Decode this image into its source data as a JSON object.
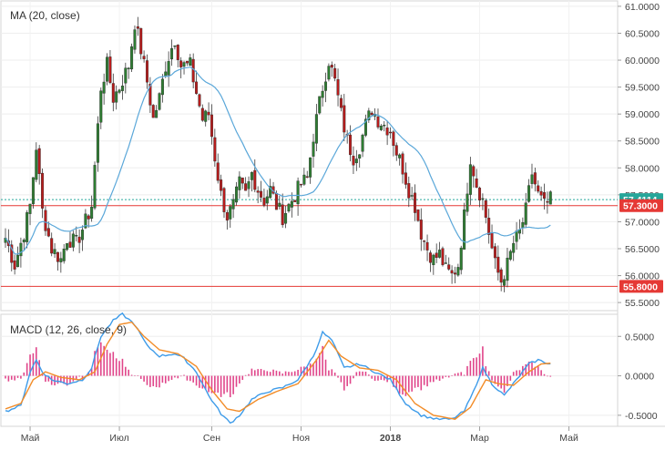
{
  "chart_data": [
    {
      "type": "candlestick",
      "title": "MA (20, close)",
      "ylim": [
        55.35,
        61.1
      ],
      "yticks": [
        "61.0000",
        "60.5000",
        "60.0000",
        "59.5000",
        "59.0000",
        "58.5000",
        "58.0000",
        "57.5000",
        "57.0000",
        "56.5000",
        "56.0000",
        "55.5000"
      ],
      "yvalues": [
        61.0,
        60.5,
        60.0,
        59.5,
        59.0,
        58.5,
        58.0,
        57.5,
        57.0,
        56.5,
        56.0,
        55.5
      ],
      "horizontal_lines": [
        {
          "label": "57.3000",
          "value": 57.3,
          "color": "#e53935"
        },
        {
          "label": "55.8000",
          "value": 55.8,
          "color": "#e53935"
        }
      ],
      "last_price": {
        "label": "57.4114",
        "value": 57.4114,
        "color": "#26a69a"
      },
      "series_colors": {
        "up": "#2e7d32",
        "down": "#b71c1c",
        "ma": "#5aa7d9"
      },
      "anchors": [
        [
          0,
          56.7
        ],
        [
          3,
          56.2
        ],
        [
          6,
          56.8
        ],
        [
          8,
          57.3
        ],
        [
          10,
          58.4
        ],
        [
          12,
          57.2
        ],
        [
          15,
          56.5
        ],
        [
          18,
          56.3
        ],
        [
          20,
          56.7
        ],
        [
          23,
          56.6
        ],
        [
          26,
          57.0
        ],
        [
          28,
          57.3
        ],
        [
          31,
          59.5
        ],
        [
          33,
          59.9
        ],
        [
          35,
          59.3
        ],
        [
          37,
          59.5
        ],
        [
          40,
          59.9
        ],
        [
          42,
          60.7
        ],
        [
          44,
          60.2
        ],
        [
          46,
          59.6
        ],
        [
          48,
          58.9
        ],
        [
          50,
          59.3
        ],
        [
          52,
          59.9
        ],
        [
          55,
          60.4
        ],
        [
          57,
          59.9
        ],
        [
          60,
          59.9
        ],
        [
          62,
          59.4
        ],
        [
          64,
          58.9
        ],
        [
          66,
          59.0
        ],
        [
          68,
          58.2
        ],
        [
          70,
          57.5
        ],
        [
          72,
          57.1
        ],
        [
          74,
          57.3
        ],
        [
          76,
          57.7
        ],
        [
          78,
          57.5
        ],
        [
          80,
          57.9
        ],
        [
          82,
          57.6
        ],
        [
          84,
          57.4
        ],
        [
          86,
          57.6
        ],
        [
          88,
          57.3
        ],
        [
          90,
          57.1
        ],
        [
          92,
          57.3
        ],
        [
          94,
          57.5
        ],
        [
          96,
          57.7
        ],
        [
          98,
          57.8
        ],
        [
          100,
          58.6
        ],
        [
          103,
          59.5
        ],
        [
          105,
          60.0
        ],
        [
          107,
          59.6
        ],
        [
          109,
          59.0
        ],
        [
          111,
          58.5
        ],
        [
          113,
          58.2
        ],
        [
          115,
          58.4
        ],
        [
          117,
          58.8
        ],
        [
          119,
          59.1
        ],
        [
          121,
          58.9
        ],
        [
          123,
          58.8
        ],
        [
          125,
          58.7
        ],
        [
          127,
          58.3
        ],
        [
          129,
          58.0
        ],
        [
          131,
          57.6
        ],
        [
          133,
          57.3
        ],
        [
          135,
          56.8
        ],
        [
          137,
          56.5
        ],
        [
          139,
          56.3
        ],
        [
          141,
          56.4
        ],
        [
          143,
          56.1
        ],
        [
          145,
          56.0
        ],
        [
          147,
          56.2
        ],
        [
          149,
          57.1
        ],
        [
          151,
          58.2
        ],
        [
          153,
          57.7
        ],
        [
          155,
          57.4
        ],
        [
          157,
          56.8
        ],
        [
          159,
          56.2
        ],
        [
          161,
          55.9
        ],
        [
          163,
          56.2
        ],
        [
          165,
          56.6
        ],
        [
          167,
          56.8
        ],
        [
          169,
          57.2
        ],
        [
          171,
          57.9
        ],
        [
          173,
          57.5
        ],
        [
          175,
          57.3
        ],
        [
          177,
          57.4
        ]
      ]
    },
    {
      "type": "macd",
      "title": "MACD (12, 26, close, 9)",
      "ylim": [
        -0.64,
        0.78
      ],
      "yticks": [
        "0.5000",
        "0.0000",
        "-0.5000"
      ],
      "yvalues": [
        0.5,
        0.0,
        -0.5
      ],
      "series_colors": {
        "macd": "#3d9be9",
        "signal": "#f28c28",
        "histogram": "#e0458a"
      },
      "macd_anchors": [
        [
          0,
          -0.45
        ],
        [
          5,
          -0.38
        ],
        [
          8,
          0.05
        ],
        [
          10,
          0.2
        ],
        [
          12,
          0.05
        ],
        [
          15,
          -0.05
        ],
        [
          20,
          -0.1
        ],
        [
          25,
          -0.05
        ],
        [
          28,
          0.1
        ],
        [
          31,
          0.5
        ],
        [
          35,
          0.7
        ],
        [
          38,
          0.78
        ],
        [
          42,
          0.65
        ],
        [
          46,
          0.38
        ],
        [
          50,
          0.25
        ],
        [
          55,
          0.28
        ],
        [
          58,
          0.22
        ],
        [
          62,
          0.05
        ],
        [
          66,
          -0.25
        ],
        [
          70,
          -0.48
        ],
        [
          73,
          -0.6
        ],
        [
          76,
          -0.5
        ],
        [
          80,
          -0.3
        ],
        [
          85,
          -0.2
        ],
        [
          90,
          -0.15
        ],
        [
          95,
          -0.05
        ],
        [
          100,
          0.25
        ],
        [
          103,
          0.55
        ],
        [
          106,
          0.45
        ],
        [
          110,
          0.1
        ],
        [
          115,
          0.15
        ],
        [
          120,
          0.05
        ],
        [
          125,
          -0.05
        ],
        [
          130,
          -0.35
        ],
        [
          135,
          -0.5
        ],
        [
          140,
          -0.55
        ],
        [
          145,
          -0.55
        ],
        [
          149,
          -0.45
        ],
        [
          152,
          -0.2
        ],
        [
          155,
          0.1
        ],
        [
          158,
          -0.1
        ],
        [
          162,
          -0.25
        ],
        [
          166,
          -0.05
        ],
        [
          170,
          0.15
        ],
        [
          173,
          0.2
        ],
        [
          177,
          0.15
        ]
      ],
      "signal_anchors": [
        [
          0,
          -0.42
        ],
        [
          5,
          -0.35
        ],
        [
          9,
          -0.05
        ],
        [
          13,
          0.05
        ],
        [
          18,
          -0.02
        ],
        [
          24,
          -0.05
        ],
        [
          29,
          0.05
        ],
        [
          33,
          0.4
        ],
        [
          37,
          0.65
        ],
        [
          41,
          0.68
        ],
        [
          45,
          0.5
        ],
        [
          50,
          0.33
        ],
        [
          56,
          0.28
        ],
        [
          62,
          0.12
        ],
        [
          67,
          -0.18
        ],
        [
          72,
          -0.42
        ],
        [
          76,
          -0.45
        ],
        [
          82,
          -0.3
        ],
        [
          88,
          -0.2
        ],
        [
          95,
          -0.1
        ],
        [
          101,
          0.2
        ],
        [
          105,
          0.45
        ],
        [
          109,
          0.25
        ],
        [
          115,
          0.1
        ],
        [
          121,
          0.07
        ],
        [
          127,
          -0.05
        ],
        [
          133,
          -0.35
        ],
        [
          139,
          -0.5
        ],
        [
          146,
          -0.55
        ],
        [
          151,
          -0.4
        ],
        [
          156,
          -0.05
        ],
        [
          160,
          -0.1
        ],
        [
          165,
          -0.12
        ],
        [
          170,
          0.05
        ],
        [
          174,
          0.15
        ],
        [
          177,
          0.16
        ]
      ]
    }
  ],
  "xaxis": {
    "labels": [
      {
        "text": "Май",
        "i": 8
      },
      {
        "text": "Июл",
        "i": 37
      },
      {
        "text": "Сен",
        "i": 67
      },
      {
        "text": "Ноя",
        "i": 96
      },
      {
        "text": "2018",
        "i": 125
      },
      {
        "text": "Мар",
        "i": 154
      },
      {
        "text": "Май",
        "i": 183
      }
    ]
  }
}
